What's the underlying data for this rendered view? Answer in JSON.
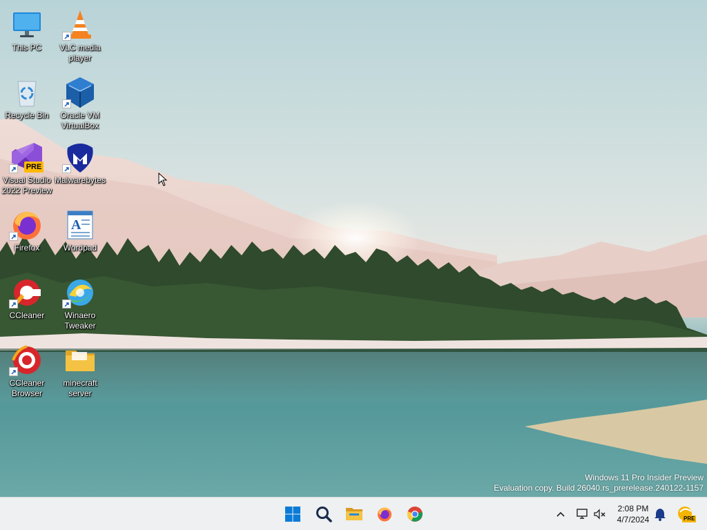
{
  "desktop": {
    "icons": [
      {
        "label": "This PC",
        "icon": "monitor-icon"
      },
      {
        "label": "VLC media player",
        "icon": "vlc-cone-icon"
      },
      {
        "label": "Recycle Bin",
        "icon": "recycle-bin-icon"
      },
      {
        "label": "Oracle VM VirtualBox",
        "icon": "virtualbox-cube-icon"
      },
      {
        "label": "Visual Studio 2022 Preview",
        "icon": "visual-studio-icon",
        "badge": "PRE"
      },
      {
        "label": "Malwarebytes",
        "icon": "malwarebytes-icon"
      },
      {
        "label": "Firefox",
        "icon": "firefox-icon"
      },
      {
        "label": "Wordpad",
        "icon": "wordpad-icon"
      },
      {
        "label": "CCleaner",
        "icon": "ccleaner-icon"
      },
      {
        "label": "Winaero Tweaker",
        "icon": "winaero-tweaker-icon"
      },
      {
        "label": "CCleaner Browser",
        "icon": "ccleaner-browser-icon"
      },
      {
        "label": "minecraft server",
        "icon": "folder-icon"
      }
    ],
    "watermark": {
      "line1": "Windows 11 Pro Insider Preview",
      "line2": "Evaluation copy. Build 26040.rs_prerelease.240122-1157"
    }
  },
  "taskbar": {
    "apps": [
      {
        "name": "Start",
        "icon": "windows-start-icon"
      },
      {
        "name": "Search",
        "icon": "search-icon"
      },
      {
        "name": "File Explorer",
        "icon": "file-explorer-icon"
      },
      {
        "name": "Firefox",
        "icon": "firefox-icon"
      },
      {
        "name": "Chrome",
        "icon": "chrome-icon"
      }
    ],
    "tray": {
      "time": "2:08 PM",
      "date": "4/7/2024",
      "dev_badge": "PRE"
    }
  },
  "colors": {
    "taskbar_bg": "#eef0f1",
    "start_blue": "#0a7bd6",
    "folder_yellow": "#f5c343"
  }
}
